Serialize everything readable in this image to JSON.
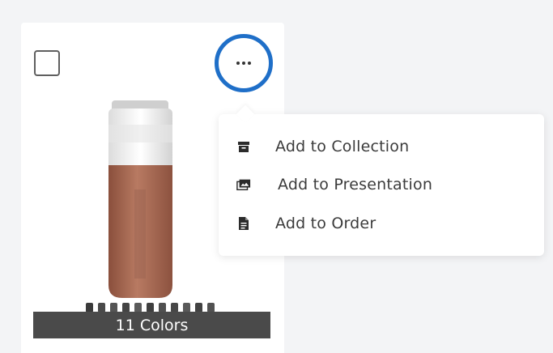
{
  "product_card": {
    "colors_label": "11 Colors",
    "accent_color": "#1f6fc8"
  },
  "actions_menu": {
    "items": [
      {
        "label": "Add to Collection",
        "icon": "archive-box-icon"
      },
      {
        "label": "Add to Presentation",
        "icon": "images-icon"
      },
      {
        "label": "Add to Order",
        "icon": "document-icon"
      }
    ]
  }
}
